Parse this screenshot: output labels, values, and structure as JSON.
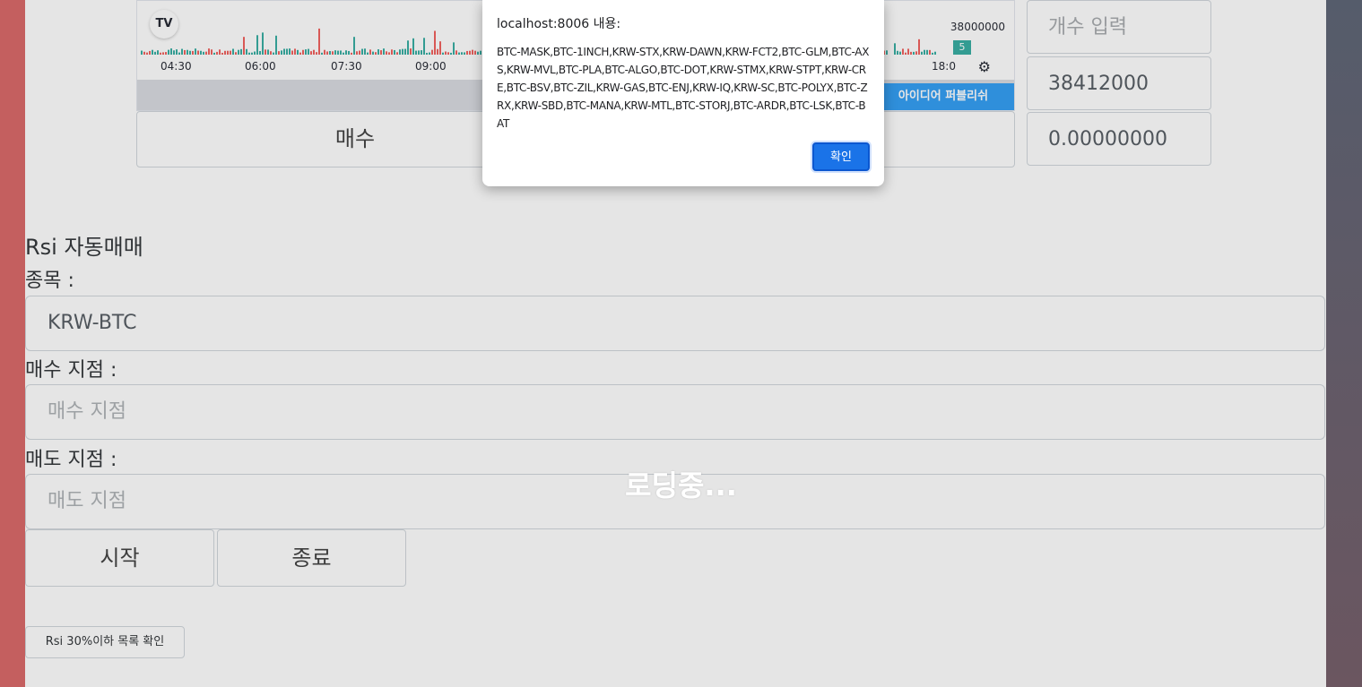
{
  "chart": {
    "times": [
      "04:30",
      "06:00",
      "07:30",
      "09:00",
      "18:0"
    ],
    "price_label": "38000000",
    "volume_badge": "5",
    "publish_label": "아이디어 퍼블리쉬"
  },
  "trade": {
    "buy_label": "매수",
    "sell_label": ""
  },
  "right_fields": {
    "quantity_placeholder": "개수 입력",
    "price_value": "38412000",
    "amount_value": "0.00000000"
  },
  "rsi": {
    "title": "Rsi 자동매매",
    "ticker_label": "종목 :",
    "ticker_value": "KRW-BTC",
    "buy_point_label": "매수 지점 :",
    "buy_point_placeholder": "매수 지점",
    "sell_point_label": "매도 지점 :",
    "sell_point_placeholder": "매도 지점",
    "start_label": "시작",
    "stop_label": "종료",
    "check_list_label": "Rsi 30%이하 목록 확인"
  },
  "loading_text": "로딩중...",
  "dialog": {
    "title": "localhost:8006 내용:",
    "message": "BTC-MASK,BTC-1INCH,KRW-STX,KRW-DAWN,KRW-FCT2,BTC-GLM,BTC-AXS,KRW-MVL,BTC-PLA,BTC-ALGO,BTC-DOT,KRW-STMX,KRW-STPT,KRW-CRE,BTC-BSV,BTC-ZIL,KRW-GAS,BTC-ENJ,KRW-IQ,KRW-SC,BTC-POLYX,BTC-ZRX,KRW-SBD,BTC-MANA,KRW-MTL,BTC-STORJ,BTC-ARDR,BTC-LSK,BTC-BAT",
    "ok_label": "확인"
  },
  "colors": {
    "accent": "#1a73e8",
    "up": "#26a69a",
    "down": "#ef5350"
  }
}
